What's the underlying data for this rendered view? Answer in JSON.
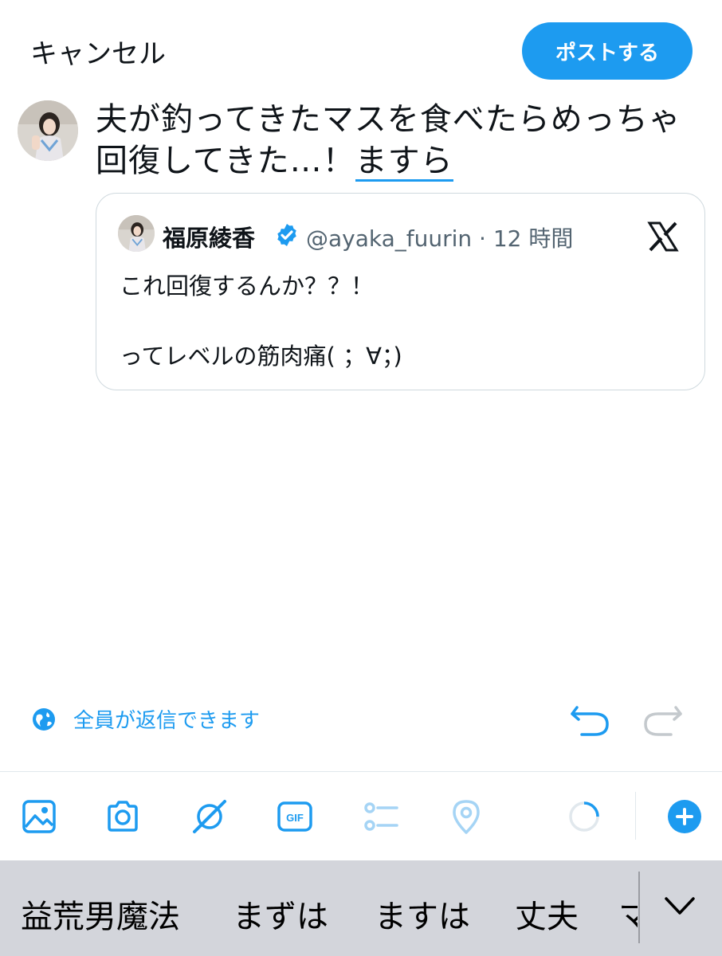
{
  "header": {
    "cancel_label": "キャンセル",
    "post_label": "ポストする"
  },
  "compose": {
    "text_main": "夫が釣ってきたマスを食べたらめっちゃ回復してきた…！",
    "text_marked": "ますら"
  },
  "quote": {
    "author_name": "福原綾香",
    "handle_time": "@ayaka_fuurin · 12 時間",
    "line1": "これ回復するんか？？！",
    "line2": "ってレベルの筋肉痛( ；∀；)"
  },
  "reply_setting": {
    "label": "全員が返信できます",
    "icon": "globe-icon"
  },
  "toolbar": {
    "icons": [
      "image-icon",
      "camera-icon",
      "grok-icon",
      "gif-icon",
      "poll-icon",
      "location-icon",
      "char-count-ring",
      "add-post-icon"
    ],
    "gif_text": "GIF"
  },
  "keyboard": {
    "suggestions": [
      "益荒男魔法",
      "まずは",
      "ますは",
      "丈夫"
    ],
    "clipped": "マ"
  },
  "colors": {
    "accent": "#1d9bf0",
    "accent_disabled": "#a5d4f5",
    "text": "#0f1419",
    "muted": "#536471",
    "keyboard_bg": "#d3d5db"
  }
}
